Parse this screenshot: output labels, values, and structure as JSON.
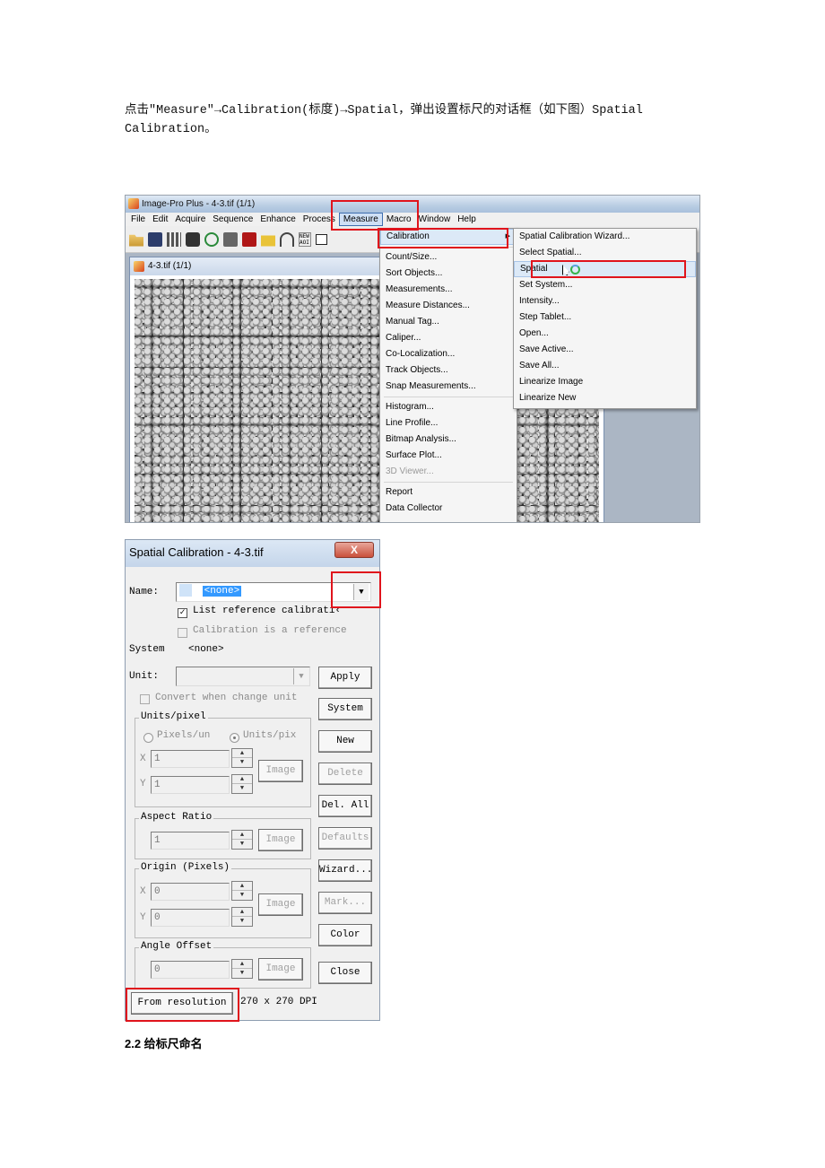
{
  "document": {
    "intro_text": "点击\"Measure\"→Calibration(标度)→Spatial，弹出设置标尺的对话框（如下图）Spatial Calibration。",
    "section_heading": "2.2 给标尺命名"
  },
  "app": {
    "window_title": "Image-Pro Plus - 4-3.tif (1/1)",
    "menubar": [
      "File",
      "Edit",
      "Acquire",
      "Sequence",
      "Enhance",
      "Process",
      "Measure",
      "Macro",
      "Window",
      "Help"
    ],
    "active_menu": "Measure",
    "toolbar_icons": [
      "open-icon",
      "save-icon",
      "grid-icon",
      "camera-icon",
      "lasso-icon",
      "print-icon",
      "book-icon",
      "mail-icon",
      "undo-icon",
      "new-aoi-icon",
      "rectangle-icon"
    ],
    "new_aoi_text": "NEW AOI",
    "subwindow_title": "4-3.tif (1/1)",
    "measure_menu": {
      "items": [
        {
          "label": "Calibration",
          "submenu": true,
          "highlighted": true
        },
        {
          "separator": true
        },
        {
          "label": "Count/Size..."
        },
        {
          "label": "Sort Objects..."
        },
        {
          "label": "Measurements..."
        },
        {
          "label": "Measure Distances..."
        },
        {
          "label": "Manual Tag..."
        },
        {
          "label": "Caliper..."
        },
        {
          "label": "Co-Localization..."
        },
        {
          "label": "Track Objects..."
        },
        {
          "label": "Snap Measurements..."
        },
        {
          "separator": true
        },
        {
          "label": "Histogram..."
        },
        {
          "label": "Line Profile..."
        },
        {
          "label": "Bitmap Analysis..."
        },
        {
          "label": "Surface Plot..."
        },
        {
          "label": "3D Viewer...",
          "disabled": true
        },
        {
          "separator": true
        },
        {
          "label": "Report"
        },
        {
          "label": "Data Collector"
        }
      ]
    },
    "calibration_menu": {
      "items": [
        {
          "label": "Spatial Calibration Wizard..."
        },
        {
          "label": "Select Spatial..."
        },
        {
          "label": "Spatial",
          "highlighted": true
        },
        {
          "label": "Set System..."
        },
        {
          "label": "Intensity..."
        },
        {
          "label": "Step Tablet..."
        },
        {
          "label": "Open..."
        },
        {
          "label": "Save Active..."
        },
        {
          "label": "Save All..."
        },
        {
          "label": "Linearize Image"
        },
        {
          "label": "Linearize New"
        }
      ]
    }
  },
  "dialog": {
    "title": "Spatial Calibration - 4-3.tif",
    "close_label": "X",
    "name_label": "Name:",
    "name_value": "<none>",
    "list_reference_label": "List reference calibrati‹",
    "list_reference_checked": true,
    "is_reference_label": "Calibration is a reference",
    "is_reference_checked": false,
    "system_label": "System",
    "system_value": "<none>",
    "unit_label": "Unit:",
    "unit_value": "",
    "convert_label": "Convert when change unit",
    "units_per_pixel": {
      "legend": "Units/pixel",
      "radio_pixels": "Pixels/un",
      "radio_units": "Units/pix",
      "x_label": "X",
      "x_value": "1",
      "y_label": "Y",
      "y_value": "1",
      "image_label": "Image"
    },
    "aspect_ratio": {
      "legend": "Aspect Ratio",
      "value": "1",
      "image_label": "Image"
    },
    "origin": {
      "legend": "Origin (Pixels)",
      "x_label": "X",
      "x_value": "0",
      "y_label": "Y",
      "y_value": "0",
      "image_label": "Image"
    },
    "angle_offset": {
      "legend": "Angle Offset",
      "value": "0",
      "image_label": "Image"
    },
    "buttons": {
      "apply": "Apply",
      "system": "System",
      "new": "New",
      "delete": "Delete",
      "del_all": "Del. All",
      "defaults": "Defaults",
      "wizard": "Wizard...",
      "mark": "Mark...",
      "color": "Color",
      "close": "Close",
      "from_resolution": "From resolution"
    },
    "resolution_text": "270 x 270 DPI"
  },
  "annotation_color": "#e0141c"
}
